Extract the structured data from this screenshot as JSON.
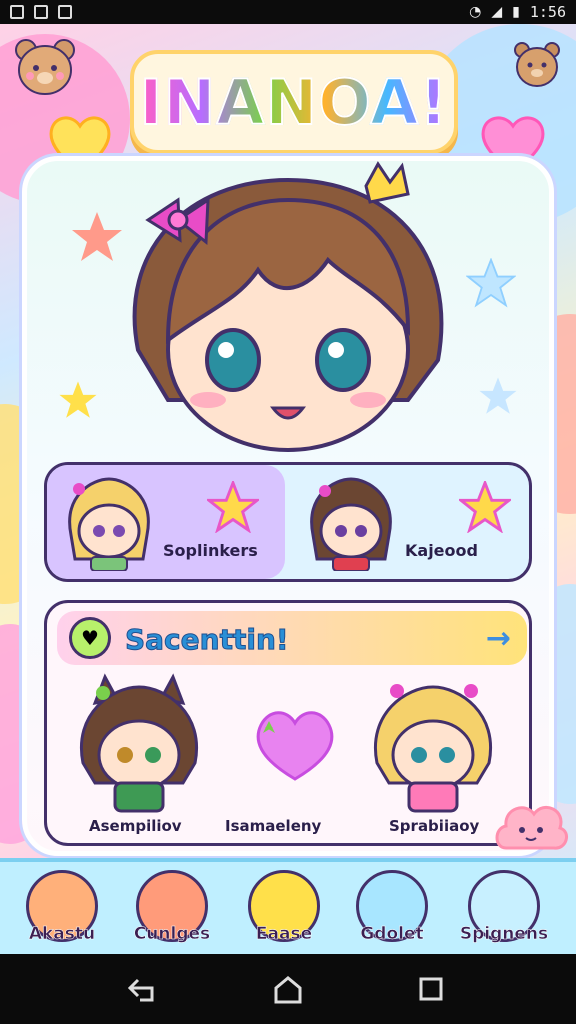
{
  "status_bar": {
    "time": "1:56",
    "icons": [
      "gallery-icon",
      "mail-icon",
      "photo-icon",
      "wifi-icon",
      "signal-icon",
      "battery-icon"
    ]
  },
  "header": {
    "title": "INANOA!"
  },
  "friends": [
    {
      "name": "Soplinkers",
      "icon": "star-icon"
    },
    {
      "name": "Kajeood",
      "icon": "star-icon"
    }
  ],
  "selection": {
    "title": "Sacenttin!",
    "arrow": "→",
    "characters": [
      {
        "label": "Asempiliov"
      },
      {
        "label": "Isamaeleny"
      },
      {
        "label": "Sprabiiaoy"
      }
    ]
  },
  "bottom_nav": [
    {
      "label": "Akastu",
      "color": "#ffb07a"
    },
    {
      "label": "Cunlges",
      "color": "#ff9b7a"
    },
    {
      "label": "Eaase",
      "color": "#ffe04a"
    },
    {
      "label": "Gdolet",
      "color": "#a8e6ff"
    },
    {
      "label": "Spignens",
      "color": "#c8f0ff"
    }
  ],
  "colors": {
    "outline": "#43306a",
    "accent_pink": "#ff5fc4",
    "accent_blue": "#47b8ff",
    "accent_yellow": "#ffd36b"
  }
}
